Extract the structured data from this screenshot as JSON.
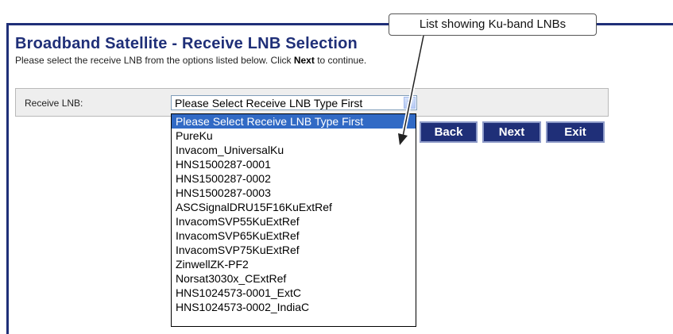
{
  "page": {
    "title": "Broadband Satellite - Receive LNB Selection",
    "instruction_pre": "Please select the receive LNB from the options listed below. Click ",
    "instruction_bold": "Next",
    "instruction_post": " to continue."
  },
  "form": {
    "label": "Receive LNB:",
    "select_value": "Please Select Receive LNB Type First"
  },
  "dropdown": {
    "options": [
      "Please Select Receive LNB Type First",
      "PureKu",
      "Invacom_UniversalKu",
      "HNS1500287-0001",
      "HNS1500287-0002",
      "HNS1500287-0003",
      "ASCSignalDRU15F16KuExtRef",
      "InvacomSVP55KuExtRef",
      "InvacomSVP65KuExtRef",
      "InvacomSVP75KuExtRef",
      "ZinwellZK-PF2",
      "Norsat3030x_CExtRef",
      "HNS1024573-0001_ExtC",
      "HNS1024573-0002_IndiaC"
    ],
    "selected_index": 0
  },
  "buttons": {
    "back": "Back",
    "next": "Next",
    "exit": "Exit"
  },
  "callout": {
    "text": "List showing Ku-band LNBs"
  },
  "colors": {
    "brand": "#1f2f78",
    "selection": "#316ac5",
    "row_background": "#eeeeee"
  }
}
